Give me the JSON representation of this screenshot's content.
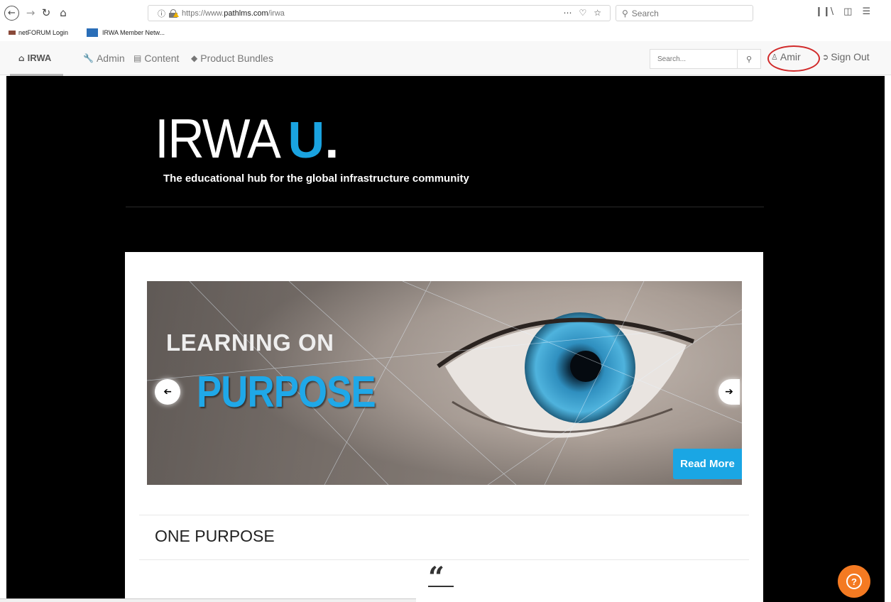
{
  "browser": {
    "url_prefix": "https://www.",
    "url_domain": "pathlms.com",
    "url_path": "/irwa",
    "search_placeholder": "Search",
    "url_actions": [
      "⋯",
      "♡",
      "☆"
    ],
    "bookmarks": [
      "netFORUM Login",
      "IRWA Member Netw..."
    ]
  },
  "navbar": {
    "home_label": "IRWA",
    "admin_label": "Admin",
    "content_label": "Content",
    "bundles_label": "Product Bundles",
    "search_placeholder": "Search...",
    "user_label": "Amir",
    "signout_label": "Sign Out"
  },
  "hero": {
    "logo_text": "IRWA",
    "logo_accent": "U",
    "logo_dot": ".",
    "tagline": "The educational hub for the global infrastructure community"
  },
  "carousel": {
    "title_line1": "LEARNING ON",
    "title_line2": "PURPOSE",
    "read_more": "Read More"
  },
  "section": {
    "title": "ONE PURPOSE",
    "quote_mark": "“"
  },
  "colors": {
    "accent": "#1aa3e0",
    "help_button": "#f47a22",
    "highlight_circle": "#d12a2a"
  }
}
